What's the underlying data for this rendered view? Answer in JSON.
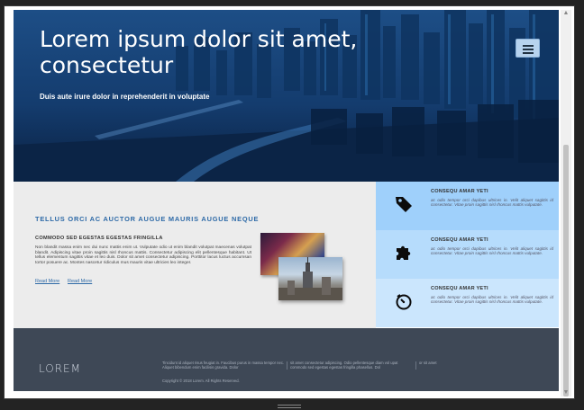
{
  "hero": {
    "title": "Lorem ipsum dolor sit amet, consectetur",
    "subtitle": "Duis aute irure dolor in reprehenderit in voluptate"
  },
  "menu": {
    "icon": "hamburger-menu-icon"
  },
  "content": {
    "title": "TELLUS ORCI AC AUCTOR AUGUE MAURIS AUGUE NEQUE",
    "subtitle": "COMMODO SED EGESTAS EGESTAS FRINGILLA",
    "body": "Non blandit massa enim nec dui nunc mattis enim ut. Vulputate odio ut enim blandit volutpat maecenas volutpat blandit. Adipiscing vitae proin sagittis nisl rhoncus mattis. Consectetur adipiscing elit pellentesque habitant. Ut tellus elementum sagittis vitae et leo duis. Dolor sit amet consectetur adipiscing. Porttitor lacus luctus accumsan tortor posuere ac. Montes nascetur ridiculus mus mauris vitae ultricies leo integer.",
    "read_more_1": "Read More",
    "read_more_2": "Read More"
  },
  "features": [
    {
      "icon": "tag-icon",
      "title": "CONSEQU AMAR YETI",
      "text": "ac odio tempor orci dapibus ultrices in. Velit aliquet sagittis id consectetur. Vitae proin sagittis nisl rhoncus mattis vulputate."
    },
    {
      "icon": "puzzle-icon",
      "title": "CONSEQU AMAR YETI",
      "text": "ac odio tempor orci dapibus ultrices in. Velit aliquet sagittis id consectetur. Vitae proin sagittis nisl rhoncus mattis vulputate."
    },
    {
      "icon": "timer-icon",
      "title": "CONSEQU AMAR YETI",
      "text": "ac odio tempor orci dapibus ultrices in. Velit aliquet sagittis id consectetur. Vitae proin sagittis nisl rhoncus mattis vulputate."
    }
  ],
  "footer": {
    "logo": "LOREM",
    "col1": "Tincidunt id aliquet risus feugiat in. Faucibus purus in massa tempor nec. Aliquet bibendum enim facilisis gravida. Dolor",
    "col2": "sit amet consectetur adipiscing. Odio pellentesque diam vol upat commodo sed egestas egestas fringilla phasellus. Dol",
    "col3": "or sit amet",
    "copyright": "Copyright © 2018 Lorem. All Rights Reserved."
  },
  "colors": {
    "accent": "#2e6aa7",
    "feature_bg_1": "#9fd0fb",
    "feature_bg_2": "#b6dcfc",
    "feature_bg_3": "#cbe6fd",
    "footer_bg": "#3e4856"
  }
}
